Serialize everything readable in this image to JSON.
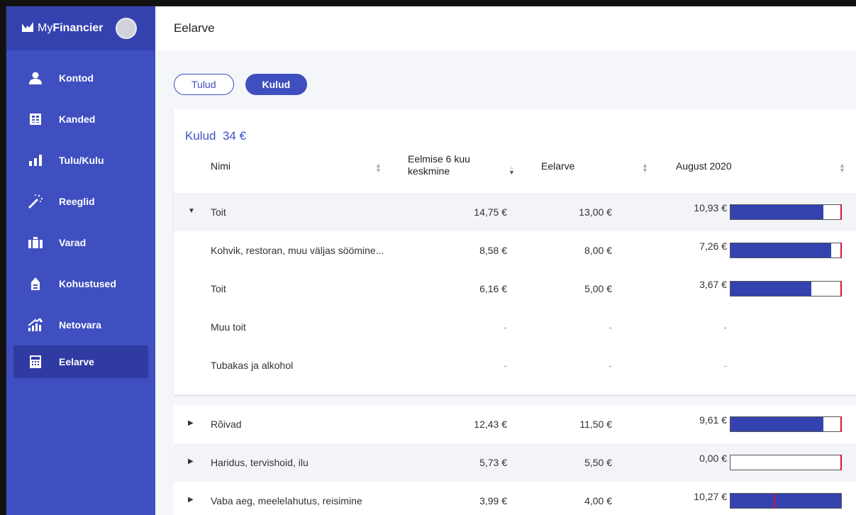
{
  "brand": {
    "prefix": "My",
    "name": "Financier"
  },
  "header": {
    "title": "Eelarve"
  },
  "sidebar": {
    "items": [
      {
        "label": "Kontod",
        "icon": "person-icon"
      },
      {
        "label": "Kanded",
        "icon": "table-icon"
      },
      {
        "label": "Tulu/Kulu",
        "icon": "bar-chart-icon"
      },
      {
        "label": "Reeglid",
        "icon": "magic-wand-icon"
      },
      {
        "label": "Varad",
        "icon": "briefcase-icon"
      },
      {
        "label": "Kohustused",
        "icon": "lock-icon"
      },
      {
        "label": "Netovara",
        "icon": "trend-chart-icon"
      },
      {
        "label": "Eelarve",
        "icon": "calculator-icon",
        "active": true
      }
    ]
  },
  "toggle": {
    "income_label": "Tulud",
    "expense_label": "Kulud",
    "selected": "Kulud"
  },
  "summary": {
    "title": "Kulud",
    "amount": "34 €"
  },
  "table": {
    "columns": {
      "name": "Nimi",
      "avg_line1": "Eelmise 6 kuu",
      "avg_line2": "keskmine",
      "budget": "Eelarve",
      "month": "August 2020"
    },
    "expanded_group": {
      "name": "Toit",
      "avg": "14,75 €",
      "budget": "13,00 €",
      "actual": "10,93 €",
      "progress": 0.84,
      "children": [
        {
          "name": "Kohvik, restoran, muu väljas söömine...",
          "avg": "8,58 €",
          "budget": "8,00 €",
          "actual": "7,26 €",
          "progress": 0.91
        },
        {
          "name": "Toit",
          "avg": "6,16 €",
          "budget": "5,00 €",
          "actual": "3,67 €",
          "progress": 0.73
        },
        {
          "name": "Muu toit",
          "avg": "-",
          "budget": "-",
          "actual": "-"
        },
        {
          "name": "Tubakas ja alkohol",
          "avg": "-",
          "budget": "-",
          "actual": "-"
        }
      ]
    },
    "collapsed_groups": [
      {
        "name": "Rõivad",
        "avg": "12,43 €",
        "budget": "11,50 €",
        "actual": "9,61 €",
        "progress": 0.84
      },
      {
        "name": "Haridus, tervishoid, ilu",
        "avg": "5,73 €",
        "budget": "5,50 €",
        "actual": "0,00 €",
        "progress": 0
      },
      {
        "name": "Vaba aeg, meelelahutus, reisimine",
        "avg": "3,99 €",
        "budget": "4,00 €",
        "actual": "10,27 €",
        "progress": 1,
        "budget_marker": 0.39
      }
    ]
  },
  "colors": {
    "primary": "#3f4fc0",
    "bar": "#3442b0",
    "marker": "#d4163a"
  }
}
